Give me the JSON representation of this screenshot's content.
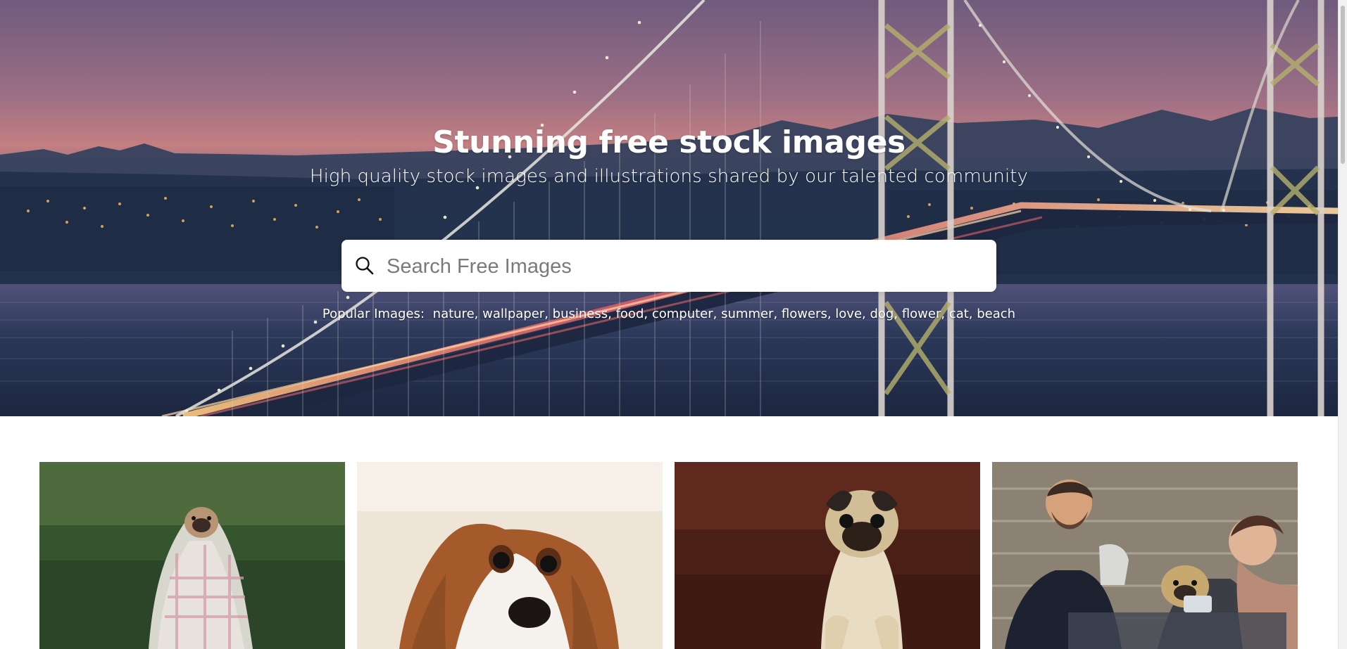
{
  "hero": {
    "title": "Stunning free stock images",
    "subtitle": "High quality stock images and illustrations shared by our talented community"
  },
  "search": {
    "placeholder": "Search Free Images"
  },
  "popular": {
    "prefix": "Popular Images:",
    "tags": [
      "nature",
      "wallpaper",
      "business",
      "food",
      "computer",
      "summer",
      "flowers",
      "love",
      "dog",
      "flower",
      "cat",
      "beach"
    ],
    "separator": ", "
  },
  "gallery": [
    {
      "name": "gallery-image-pug-blanket"
    },
    {
      "name": "gallery-image-spaniel-puppy"
    },
    {
      "name": "gallery-image-pug-standing"
    },
    {
      "name": "gallery-image-couple-with-pug"
    }
  ]
}
